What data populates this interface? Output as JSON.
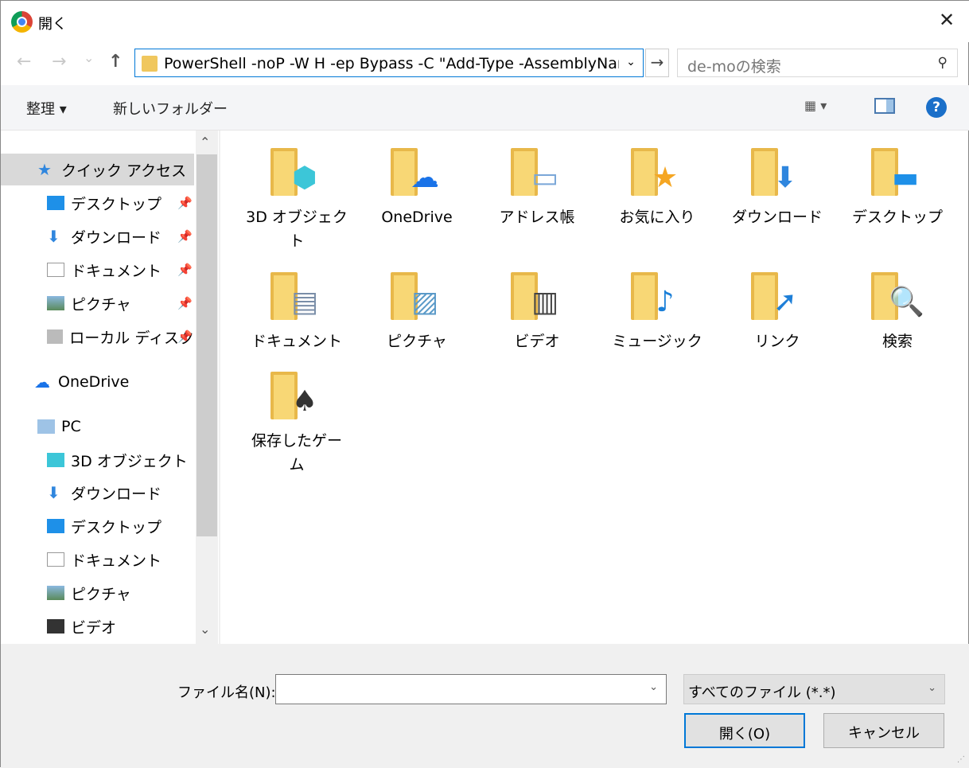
{
  "window": {
    "title": "開く",
    "close": "✕"
  },
  "nav": {
    "back": "←",
    "forward": "→",
    "recent": "⌄",
    "up": "↑",
    "address": "PowerShell -noP -W H -ep Bypass -C \"Add-Type -AssemblyName",
    "address_dropdown": "⌄",
    "refresh": "→",
    "search_placeholder": "de-moの検索",
    "search_icon": "⚲"
  },
  "toolbar": {
    "organize": "整理 ▾",
    "new_folder": "新しいフォルダー",
    "view": "▦ ▾",
    "pane": "▯",
    "help": "?"
  },
  "sidebar": {
    "items": [
      {
        "label": "クイック アクセス",
        "icon": "star-icon",
        "pinned": false
      },
      {
        "label": "デスクトップ",
        "icon": "desktop-icon",
        "pinned": true
      },
      {
        "label": "ダウンロード",
        "icon": "download-icon",
        "pinned": true
      },
      {
        "label": "ドキュメント",
        "icon": "document-icon",
        "pinned": true
      },
      {
        "label": "ピクチャ",
        "icon": "picture-icon",
        "pinned": true
      },
      {
        "label": "ローカル ディスク",
        "icon": "disk-icon",
        "pinned": true
      },
      {
        "label": "OneDrive",
        "icon": "cloud-icon",
        "pinned": false
      },
      {
        "label": "PC",
        "icon": "pc-icon",
        "pinned": false
      },
      {
        "label": "3D オブジェクト",
        "icon": "cube-icon",
        "pinned": false
      },
      {
        "label": "ダウンロード",
        "icon": "download-icon",
        "pinned": false
      },
      {
        "label": "デスクトップ",
        "icon": "desktop-icon",
        "pinned": false
      },
      {
        "label": "ドキュメント",
        "icon": "document-icon",
        "pinned": false
      },
      {
        "label": "ピクチャ",
        "icon": "picture-icon",
        "pinned": false
      },
      {
        "label": "ビデオ",
        "icon": "video-icon",
        "pinned": false
      }
    ],
    "pin": "📌",
    "scroll_up": "⌃",
    "scroll_down": "⌄"
  },
  "files": [
    {
      "label": "3D オブジェクト",
      "glyph": "⬢",
      "color": "#3cc6d8"
    },
    {
      "label": "OneDrive",
      "glyph": "☁",
      "color": "#1a73e8"
    },
    {
      "label": "アドレス帳",
      "glyph": "▭",
      "color": "#7aa7d8"
    },
    {
      "label": "お気に入り",
      "glyph": "★",
      "color": "#f5a623"
    },
    {
      "label": "ダウンロード",
      "glyph": "⬇",
      "color": "#2f86de"
    },
    {
      "label": "デスクトップ",
      "glyph": "▬",
      "color": "#1e90e8"
    },
    {
      "label": "ドキュメント",
      "glyph": "▤",
      "color": "#7a8ea8"
    },
    {
      "label": "ピクチャ",
      "glyph": "▨",
      "color": "#5a9ac8"
    },
    {
      "label": "ビデオ",
      "glyph": "▥",
      "color": "#444444"
    },
    {
      "label": "ミュージック",
      "glyph": "♪",
      "color": "#1a7fd8"
    },
    {
      "label": "リンク",
      "glyph": "➚",
      "color": "#1e7fd8"
    },
    {
      "label": "検索",
      "glyph": "🔍",
      "color": "#6a8aa8"
    },
    {
      "label": "保存したゲーム",
      "glyph": "♠",
      "color": "#333333"
    }
  ],
  "bottom": {
    "filename_label": "ファイル名(N):",
    "filename_value": "",
    "filename_dropdown": "⌄",
    "filetype": "すべてのファイル (*.*)",
    "filetype_dropdown": "⌄",
    "open": "開く(O)",
    "cancel": "キャンセル"
  }
}
